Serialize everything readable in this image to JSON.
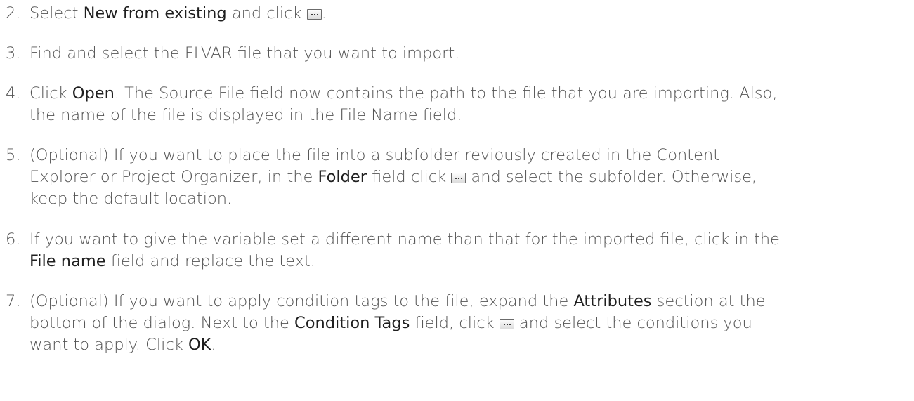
{
  "steps": [
    {
      "number": "2.",
      "parts": [
        {
          "t": "text",
          "v": "Select "
        },
        {
          "t": "bold",
          "v": "New from existing"
        },
        {
          "t": "text",
          "v": " and click "
        },
        {
          "t": "icon",
          "v": "browse-button-icon"
        },
        {
          "t": "text",
          "v": "."
        }
      ]
    },
    {
      "number": "3.",
      "parts": [
        {
          "t": "text",
          "v": "Find and select the FLVAR file that you want to import."
        }
      ]
    },
    {
      "number": "4.",
      "parts": [
        {
          "t": "text",
          "v": "Click "
        },
        {
          "t": "bold",
          "v": "Open"
        },
        {
          "t": "text",
          "v": ". The Source File field now contains the path to the file that you are importing. Also,"
        },
        {
          "t": "br"
        },
        {
          "t": "text",
          "v": "the name of the file is displayed in the File Name field."
        }
      ]
    },
    {
      "number": "5.",
      "parts": [
        {
          "t": "text",
          "v": "(Optional) If you want to place the file into a subfolder  reviously created in the Content"
        },
        {
          "t": "br"
        },
        {
          "t": "text",
          "v": "Explorer or Project Organizer, in the "
        },
        {
          "t": "bold",
          "v": "Folder"
        },
        {
          "t": "text",
          "v": " field click "
        },
        {
          "t": "icon",
          "v": "browse-button-icon"
        },
        {
          "t": "text",
          "v": " and select the subfolder. Otherwise,"
        },
        {
          "t": "br"
        },
        {
          "t": "text",
          "v": "keep the default location."
        }
      ]
    },
    {
      "number": "6.",
      "parts": [
        {
          "t": "text",
          "v": "If you want to give the variable set a different name than that for the imported file, click in the"
        },
        {
          "t": "br"
        },
        {
          "t": "bold",
          "v": "File name"
        },
        {
          "t": "text",
          "v": " field and replace the text."
        }
      ]
    },
    {
      "number": "7.",
      "parts": [
        {
          "t": "text",
          "v": "(Optional) If you want to apply condition tags to the file, expand the "
        },
        {
          "t": "bold",
          "v": "Attributes"
        },
        {
          "t": "text",
          "v": " section at the"
        },
        {
          "t": "br"
        },
        {
          "t": "text",
          "v": "bottom of the dialog. Next to the "
        },
        {
          "t": "bold",
          "v": "Condition Tags"
        },
        {
          "t": "text",
          "v": " field, click "
        },
        {
          "t": "icon",
          "v": "browse-button-icon"
        },
        {
          "t": "text",
          "v": " and select the conditions you"
        },
        {
          "t": "br"
        },
        {
          "t": "text",
          "v": "want to apply. Click "
        },
        {
          "t": "bold",
          "v": "OK"
        },
        {
          "t": "text",
          "v": "."
        }
      ]
    }
  ]
}
